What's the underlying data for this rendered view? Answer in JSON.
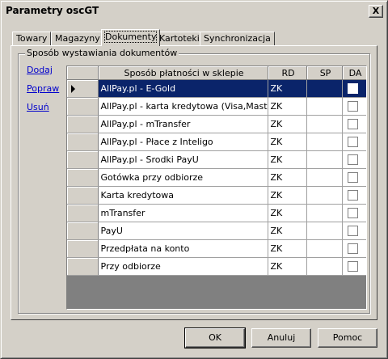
{
  "window": {
    "title": "Parametry oscGT",
    "close": "X"
  },
  "tabs": [
    {
      "label": "Towary"
    },
    {
      "label": "Magazyny"
    },
    {
      "label": "Dokumenty"
    },
    {
      "label": "Kartoteki"
    },
    {
      "label": "Synchronizacja"
    }
  ],
  "group": {
    "label": "Sposób wystawiania dokumentów",
    "links": {
      "add": "Dodaj",
      "edit": "Popraw",
      "delete": "Usuń"
    }
  },
  "grid": {
    "headers": {
      "name": "Sposób płatności w sklepie",
      "rd": "RD",
      "sp": "SP",
      "da": "DA"
    },
    "rows": [
      {
        "name": "AllPay.pl - E-Gold",
        "rd": "ZK",
        "sp": ""
      },
      {
        "name": "AllPay.pl - karta kredytowa (Visa,MasterCard)",
        "rd": "ZK",
        "sp": ""
      },
      {
        "name": "AllPay.pl - mTransfer",
        "rd": "ZK",
        "sp": ""
      },
      {
        "name": "AllPay.pl - Płace z Inteligo",
        "rd": "ZK",
        "sp": ""
      },
      {
        "name": "AllPay.pl - Srodki PayU",
        "rd": "ZK",
        "sp": ""
      },
      {
        "name": "Gotówka przy odbiorze",
        "rd": "ZK",
        "sp": ""
      },
      {
        "name": "Karta kredytowa",
        "rd": "ZK",
        "sp": ""
      },
      {
        "name": "mTransfer",
        "rd": "ZK",
        "sp": ""
      },
      {
        "name": "PayU",
        "rd": "ZK",
        "sp": ""
      },
      {
        "name": "Przedpłata na konto",
        "rd": "ZK",
        "sp": ""
      },
      {
        "name": "Przy odbiorze",
        "rd": "ZK",
        "sp": ""
      }
    ]
  },
  "buttons": {
    "ok": "OK",
    "cancel": "Anuluj",
    "help": "Pomoc"
  }
}
